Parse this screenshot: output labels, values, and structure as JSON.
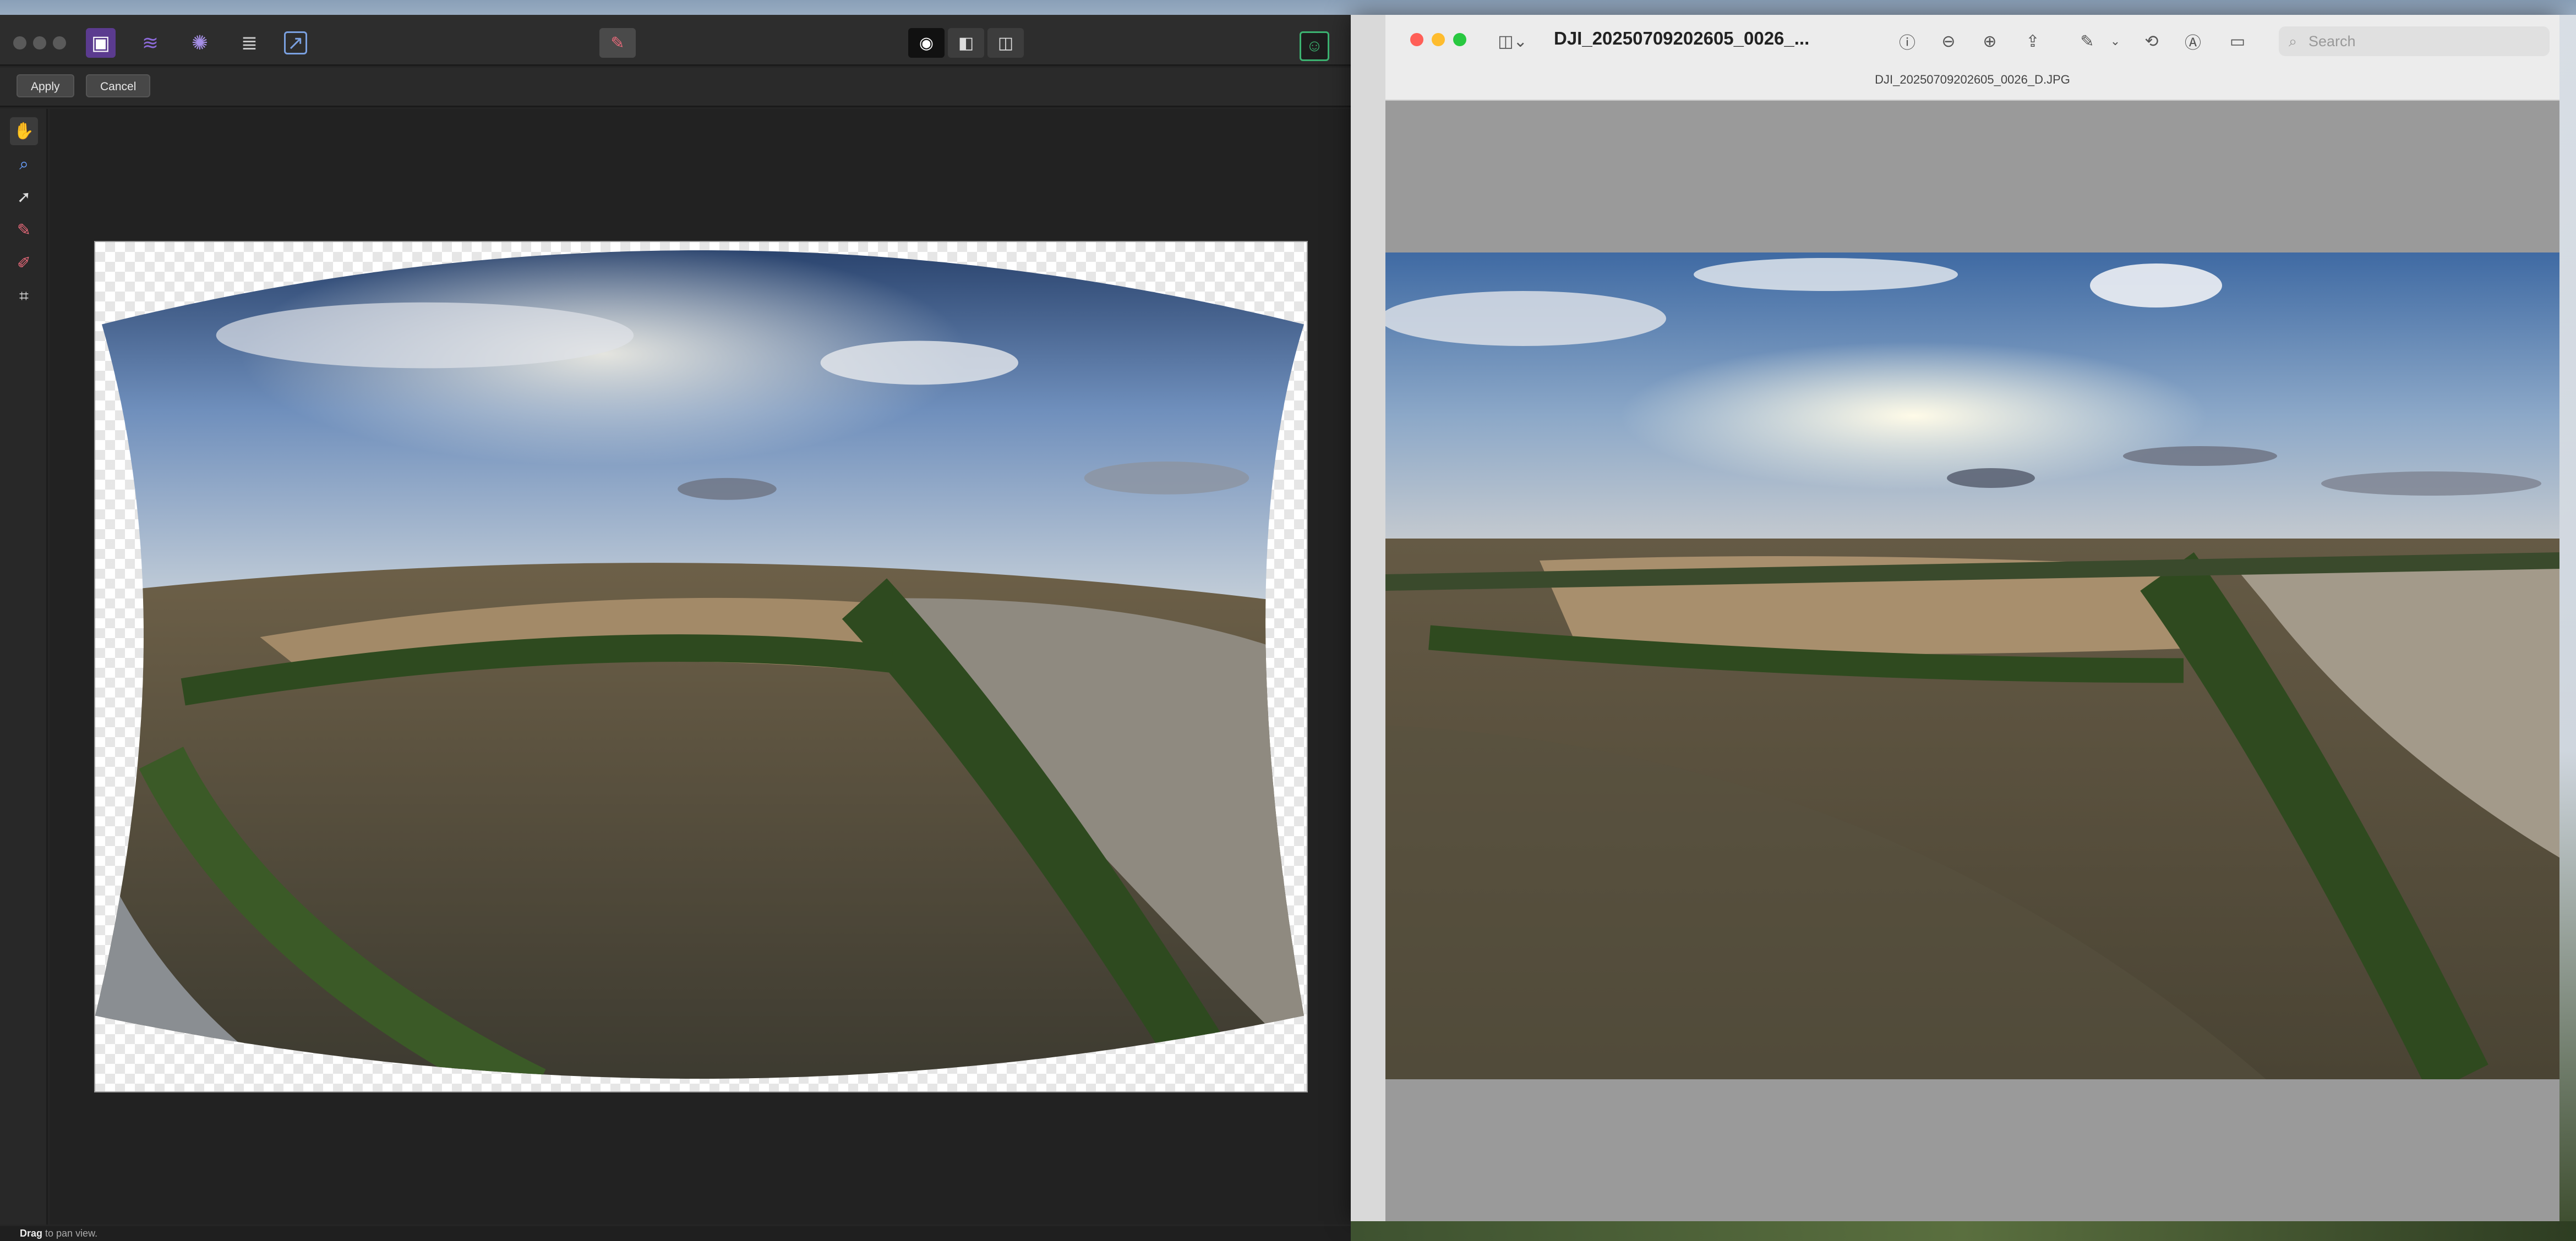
{
  "affinity": {
    "context_bar": {
      "apply": "Apply",
      "cancel": "Cancel"
    },
    "status": {
      "bold": "Drag",
      "text": " to pan view."
    },
    "personas": [
      "photo-persona-icon",
      "liquify-persona-icon",
      "develop-persona-icon",
      "tone-mapping-persona-icon",
      "export-persona-icon"
    ],
    "tools": [
      "hand-icon",
      "zoom-icon",
      "move-icon",
      "brush-icon",
      "eraser-icon",
      "crop-icon"
    ]
  },
  "preview": {
    "title": "DJI_20250709202605_0026_...",
    "subtitle": "DJI_20250709202605_0026_D.JPG",
    "search_placeholder": "Search"
  },
  "colors": {
    "affinity_bg": "#252525",
    "mac_red": "#ff5f57",
    "mac_yellow": "#febc2e",
    "mac_green": "#28c840",
    "preview_gutter": "#9a9a9a"
  }
}
